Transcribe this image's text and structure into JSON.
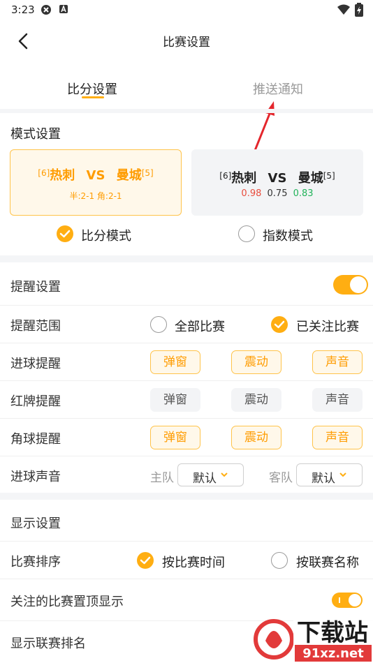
{
  "status_bar": {
    "time": "3:23"
  },
  "header": {
    "title": "比赛设置"
  },
  "tabs": [
    {
      "label": "比分设置",
      "active": true
    },
    {
      "label": "推送通知",
      "active": false
    }
  ],
  "mode_section": {
    "title": "模式设置",
    "score_card": {
      "rank_home": "[6]",
      "home": "热刺",
      "vs": "VS",
      "away": "曼城",
      "rank_away": "[5]",
      "detail": "半:2-1  角:2-1"
    },
    "index_card": {
      "rank_home": "[6]",
      "home": "热刺",
      "vs": "VS",
      "away": "曼城",
      "rank_away": "[5]",
      "odd1": "0.98",
      "odd2": "0.75",
      "odd3": "0.83"
    },
    "options": [
      {
        "label": "比分模式",
        "selected": true
      },
      {
        "label": "指数模式",
        "selected": false
      }
    ]
  },
  "reminder_section": {
    "title": "提醒设置",
    "enabled": true,
    "scope": {
      "label": "提醒范围",
      "options": [
        {
          "label": "全部比赛",
          "selected": false
        },
        {
          "label": "已关注比赛",
          "selected": true
        }
      ]
    },
    "goal": {
      "label": "进球提醒",
      "buttons": [
        {
          "label": "弹窗",
          "on": true
        },
        {
          "label": "震动",
          "on": true
        },
        {
          "label": "声音",
          "on": true
        }
      ]
    },
    "red_card": {
      "label": "红牌提醒",
      "buttons": [
        {
          "label": "弹窗",
          "on": false
        },
        {
          "label": "震动",
          "on": false
        },
        {
          "label": "声音",
          "on": false
        }
      ]
    },
    "corner": {
      "label": "角球提醒",
      "buttons": [
        {
          "label": "弹窗",
          "on": true
        },
        {
          "label": "震动",
          "on": true
        },
        {
          "label": "声音",
          "on": true
        }
      ]
    },
    "goal_sound": {
      "label": "进球声音",
      "home_prefix": "主队",
      "home_value": "默认",
      "away_prefix": "客队",
      "away_value": "默认"
    }
  },
  "display_section": {
    "title": "显示设置",
    "sort": {
      "label": "比赛排序",
      "options": [
        {
          "label": "按比赛时间",
          "selected": true
        },
        {
          "label": "按联赛名称",
          "selected": false
        }
      ]
    },
    "pin_followed": {
      "label": "关注的比赛置顶显示",
      "enabled": true
    },
    "show_rank": {
      "label": "显示联赛排名"
    }
  },
  "watermark": {
    "text1": "下载站",
    "text2": "91xz.net"
  },
  "colors": {
    "accent": "#ffae12",
    "accent_text": "#ff9c00",
    "odds_red": "#e84c3d",
    "odds_green": "#21b35a",
    "annotation_red": "#e4262c"
  }
}
